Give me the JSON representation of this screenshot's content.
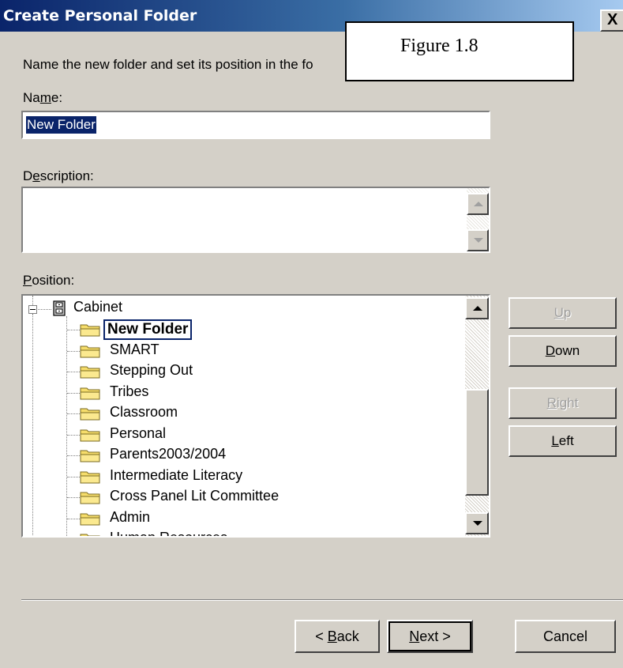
{
  "window": {
    "title": "Create Personal Folder",
    "close_glyph": "X"
  },
  "overlay": {
    "figure_label": "Figure 1.8"
  },
  "form": {
    "instruction": "Name the new folder and set its position in the fo",
    "name_label": "Name:",
    "name_value": "New Folder",
    "description_label": "Description:",
    "description_value": "",
    "position_label": "Position:"
  },
  "tree": {
    "root_label": "Cabinet",
    "items": [
      {
        "label": "New Folder",
        "selected": true
      },
      {
        "label": "SMART"
      },
      {
        "label": "Stepping Out"
      },
      {
        "label": "Tribes"
      },
      {
        "label": "Classroom"
      },
      {
        "label": "Personal"
      },
      {
        "label": "Parents2003/2004"
      },
      {
        "label": "Intermediate Literacy"
      },
      {
        "label": "Cross Panel Lit Committee"
      },
      {
        "label": "Admin"
      },
      {
        "label": "Human Resources"
      }
    ]
  },
  "side_buttons": {
    "up": "Up",
    "down": "Down",
    "right": "Right",
    "left": "Left"
  },
  "footer": {
    "back": "< Back",
    "next": "Next >",
    "cancel": "Cancel"
  },
  "colors": {
    "dialog_bg": "#d4d0c8",
    "titlebar_start": "#0a246a",
    "titlebar_end": "#a6caf0",
    "selection_bg": "#0a246a",
    "folder_yellow": "#f6dd6b"
  },
  "icons": [
    "close-icon",
    "expander-icon",
    "cabinet-icon",
    "folder-icon",
    "scroll-up-arrow-icon",
    "scroll-down-arrow-icon"
  ]
}
